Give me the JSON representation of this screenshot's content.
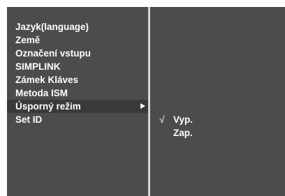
{
  "menu": {
    "items": [
      {
        "label": "Jazyk(language)"
      },
      {
        "label": "Země"
      },
      {
        "label": "Označení vstupu"
      },
      {
        "label": "SIMPLINK"
      },
      {
        "label": "Zámek Kláves"
      },
      {
        "label": "Metoda ISM"
      },
      {
        "label": "Úsporný režim",
        "selected": true
      },
      {
        "label": "Set ID"
      }
    ]
  },
  "submenu": {
    "check_symbol": "√",
    "options": [
      {
        "label": "Vyp.",
        "checked": true
      },
      {
        "label": "Zap.",
        "checked": false
      }
    ]
  },
  "icons": {
    "submenu_arrow": "right-triangle-icon",
    "check": "checkmark-icon"
  },
  "colors": {
    "panel_bg": "#4c4c4c",
    "highlight_bg": "#3a3a3a",
    "divider": "#d6d6d6",
    "text": "#ffffff"
  }
}
